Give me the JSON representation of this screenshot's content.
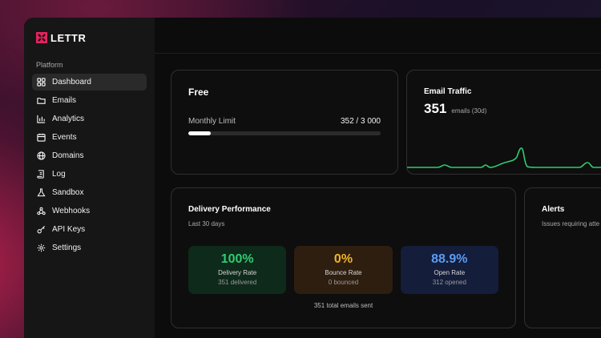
{
  "app": {
    "logo_text": "LETTR"
  },
  "sidebar": {
    "section": "Platform",
    "items": [
      {
        "label": "Dashboard",
        "icon": "dashboard-icon"
      },
      {
        "label": "Emails",
        "icon": "folder-icon"
      },
      {
        "label": "Analytics",
        "icon": "bar-chart-icon"
      },
      {
        "label": "Events",
        "icon": "calendar-icon"
      },
      {
        "label": "Domains",
        "icon": "globe-icon"
      },
      {
        "label": "Log",
        "icon": "scroll-icon"
      },
      {
        "label": "Sandbox",
        "icon": "flask-icon"
      },
      {
        "label": "Webhooks",
        "icon": "webhook-icon"
      },
      {
        "label": "API Keys",
        "icon": "key-icon"
      },
      {
        "label": "Settings",
        "icon": "gear-icon"
      }
    ]
  },
  "plan": {
    "title": "Free",
    "limit_label": "Monthly Limit",
    "limit_value": "352 / 3 000",
    "usage_fraction": 0.117
  },
  "traffic": {
    "title": "Email Traffic",
    "count": "351",
    "subtitle": "emails (30d)",
    "line_color": "#2ecc71"
  },
  "performance": {
    "title": "Delivery Performance",
    "subtitle": "Last 30 days",
    "stats": [
      {
        "value": "100%",
        "label": "Delivery Rate",
        "sub": "351 delivered",
        "color": "#2ecc71"
      },
      {
        "value": "0%",
        "label": "Bounce Rate",
        "sub": "0 bounced",
        "color": "#f0b429"
      },
      {
        "value": "88.9%",
        "label": "Open Rate",
        "sub": "312 opened",
        "color": "#5b9bf5"
      }
    ],
    "total": "351 total emails sent"
  },
  "alerts": {
    "title": "Alerts",
    "subtitle": "Issues requiring atte"
  }
}
